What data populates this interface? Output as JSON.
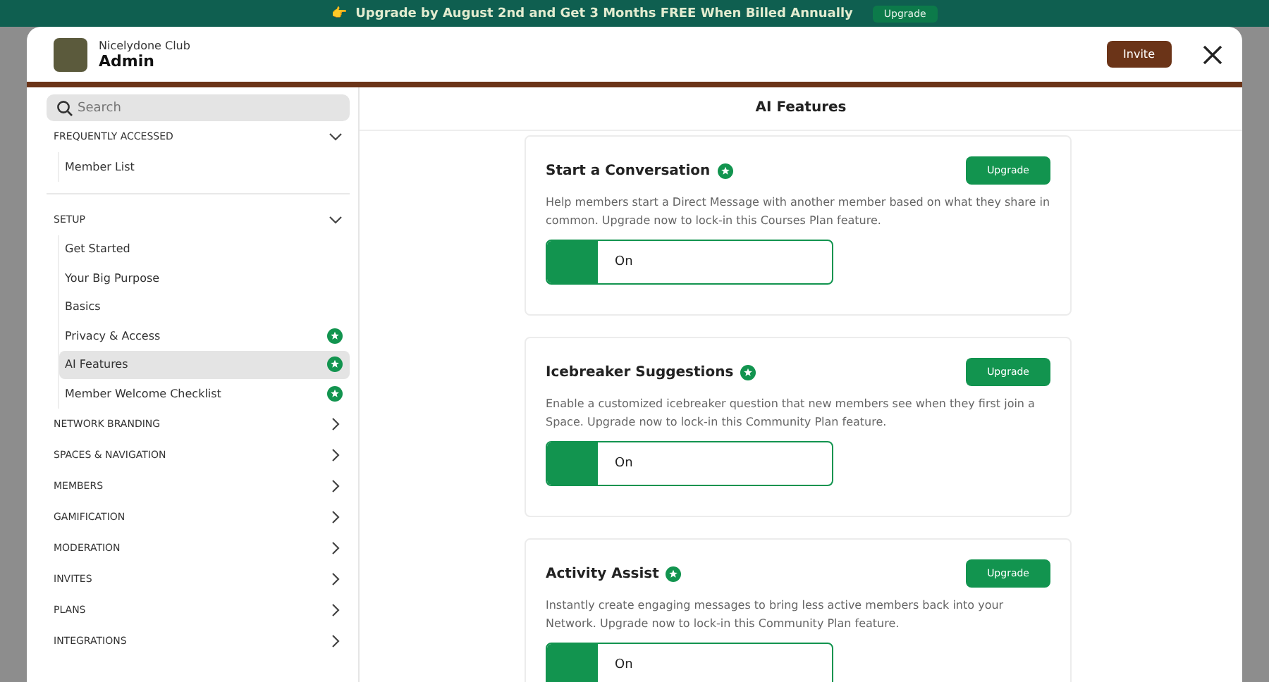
{
  "banner": {
    "icon": "👉",
    "text": "Upgrade by August 2nd and Get 3 Months FREE When Billed Annually",
    "button": "Upgrade"
  },
  "header": {
    "community": "Nicelydone Club",
    "title": "Admin",
    "invite": "Invite"
  },
  "sidebar": {
    "search": {
      "placeholder": "Search"
    },
    "sections": [
      {
        "title": "FREQUENTLY ACCESSED",
        "expanded": true,
        "divider": true,
        "items": [
          {
            "label": "Member List",
            "selected": false,
            "premium": false
          }
        ]
      },
      {
        "title": "SETUP",
        "expanded": true,
        "items": [
          {
            "label": "Get Started",
            "selected": false,
            "premium": false
          },
          {
            "label": "Your Big Purpose",
            "selected": false,
            "premium": false
          },
          {
            "label": "Basics",
            "selected": false,
            "premium": false
          },
          {
            "label": "Privacy & Access",
            "selected": false,
            "premium": true
          },
          {
            "label": "AI Features",
            "selected": true,
            "premium": true
          },
          {
            "label": "Member Welcome Checklist",
            "selected": false,
            "premium": true
          }
        ]
      },
      {
        "title": "NETWORK BRANDING",
        "expanded": false
      },
      {
        "title": "SPACES & NAVIGATION",
        "expanded": false
      },
      {
        "title": "MEMBERS",
        "expanded": false
      },
      {
        "title": "GAMIFICATION",
        "expanded": false
      },
      {
        "title": "MODERATION",
        "expanded": false
      },
      {
        "title": "INVITES",
        "expanded": false
      },
      {
        "title": "PLANS",
        "expanded": false
      },
      {
        "title": "INTEGRATIONS",
        "expanded": false
      }
    ]
  },
  "main": {
    "title": "AI Features",
    "features": [
      {
        "title": "Start a Conversation",
        "button": "Upgrade",
        "description": "Help members start a Direct Message with another member based on what they share in common. Upgrade now to lock-in this Courses Plan feature.",
        "toggle": {
          "label": "On",
          "on": true
        }
      },
      {
        "title": "Icebreaker Suggestions",
        "button": "Upgrade",
        "description": "Enable a customized icebreaker question that new members see when they first join a Space. Upgrade now to lock-in this Community Plan feature.",
        "toggle": {
          "label": "On",
          "on": true
        }
      },
      {
        "title": "Activity Assist",
        "button": "Upgrade",
        "description": "Instantly create engaging messages to bring less active members back into your Network. Upgrade now to lock-in this Community Plan feature.",
        "toggle": {
          "label": "On",
          "on": true
        }
      }
    ]
  }
}
